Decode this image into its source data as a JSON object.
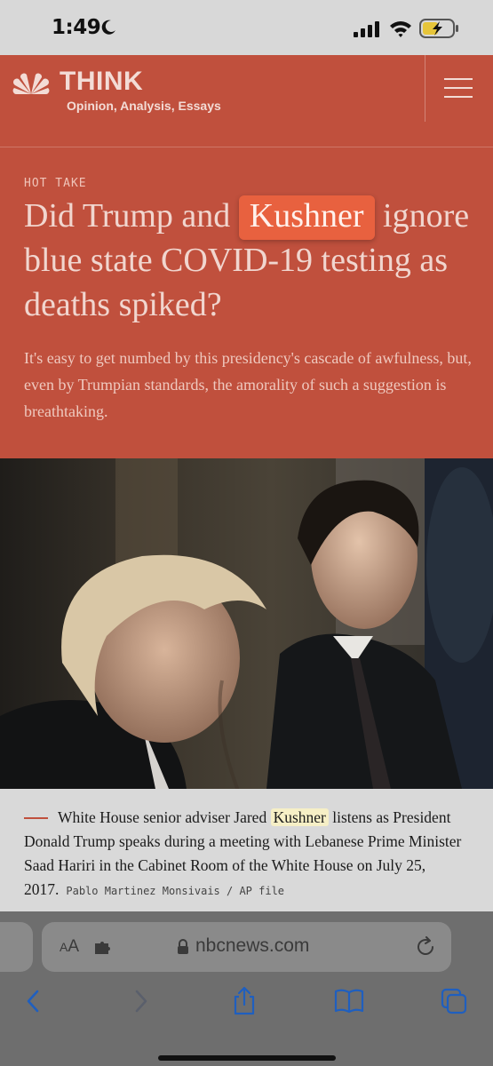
{
  "status_bar": {
    "time": "1:49"
  },
  "header": {
    "brand": "THINK",
    "tagline": "Opinion, Analysis, Essays"
  },
  "article": {
    "kicker": "HOT TAKE",
    "headline_before": "Did Trump and ",
    "headline_highlight": "Kushner",
    "headline_after": " ignore blue state COVID-19 testing as deaths spiked?",
    "dek": "It's easy to get numbed by this presidency's cascade of awfulness, but, even by Trumpian standards, the amorality of such a suggestion is breathtaking."
  },
  "caption": {
    "before": "White House senior adviser Jared ",
    "highlight": "Kushner",
    "after": " listens as President Donald Trump speaks during a meeting with Lebanese Prime Minister Saad Hariri in the Cabinet Room of the White House on July 25, 2017.",
    "credit": "Pablo Martinez Monsivais / AP file"
  },
  "browser": {
    "reader_label_small": "A",
    "reader_label_large": "A",
    "url": "nbcnews.com"
  },
  "colors": {
    "brand_red": "#c0503d",
    "highlight_orange": "#e8613f",
    "browser_blue": "#1f5fbf"
  }
}
